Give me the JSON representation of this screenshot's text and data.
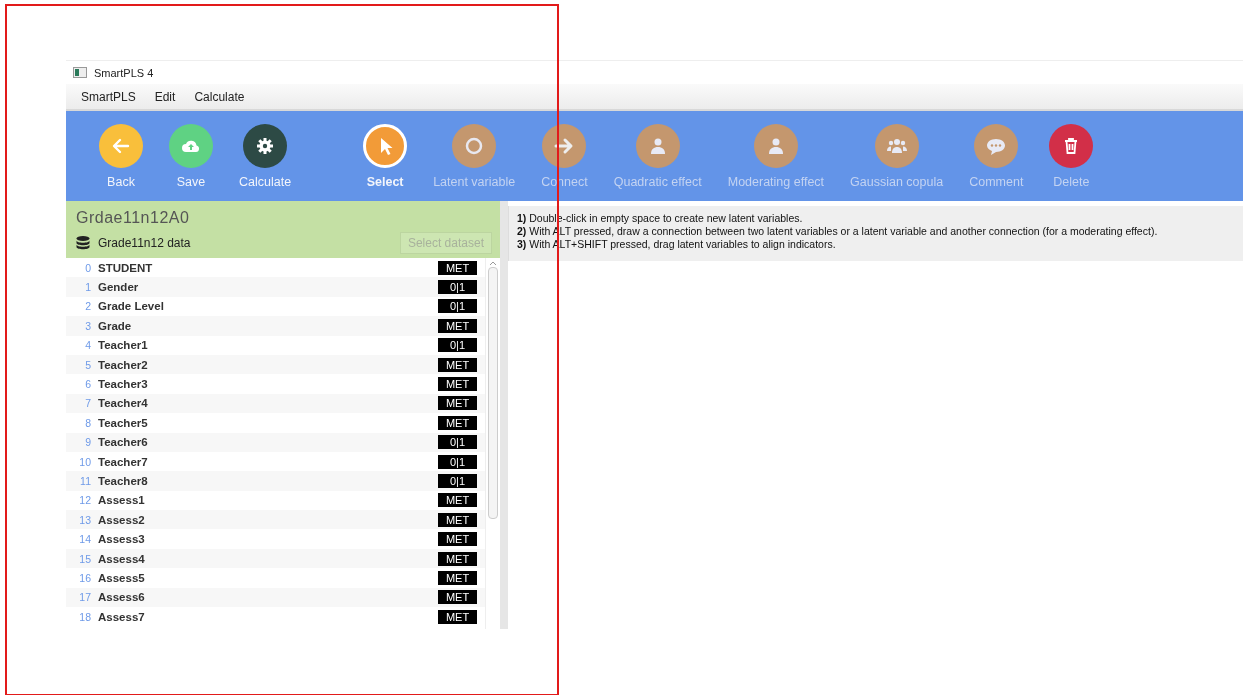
{
  "window": {
    "title": "SmartPLS 4"
  },
  "menu": [
    "SmartPLS",
    "Edit",
    "Calculate"
  ],
  "toolbar": [
    {
      "label": "Back",
      "kind": "back",
      "color": "#f9bf3b",
      "disabled": false,
      "selected": false
    },
    {
      "label": "Save",
      "kind": "save",
      "color": "#5fd283",
      "disabled": false,
      "selected": false
    },
    {
      "label": "Calculate",
      "kind": "gear",
      "color": "#2d4a45",
      "disabled": false,
      "selected": false
    },
    {
      "label": "Select",
      "kind": "pointer",
      "color": "#f29b38",
      "disabled": false,
      "selected": true
    },
    {
      "label": "Latent variable",
      "kind": "circle",
      "color": "#c4976e",
      "disabled": true,
      "selected": false
    },
    {
      "label": "Connect",
      "kind": "arrow",
      "color": "#c4976e",
      "disabled": true,
      "selected": false
    },
    {
      "label": "Quadratic effect",
      "kind": "person",
      "color": "#c4976e",
      "disabled": true,
      "selected": false
    },
    {
      "label": "Moderating effect",
      "kind": "person",
      "color": "#c4976e",
      "disabled": true,
      "selected": false
    },
    {
      "label": "Gaussian copula",
      "kind": "people",
      "color": "#c4976e",
      "disabled": true,
      "selected": false
    },
    {
      "label": "Comment",
      "kind": "comment",
      "color": "#c4976e",
      "disabled": true,
      "selected": false
    },
    {
      "label": "Delete",
      "kind": "trash",
      "color": "#d22f48",
      "disabled": true,
      "selected": false
    }
  ],
  "project": {
    "name": "Grdae11n12A0",
    "dataset": "Grade11n12 data",
    "select_button": "Select dataset"
  },
  "variables": [
    {
      "index": "0",
      "name": "STUDENT",
      "type": "MET"
    },
    {
      "index": "1",
      "name": "Gender",
      "type": "0|1"
    },
    {
      "index": "2",
      "name": "Grade Level",
      "type": "0|1"
    },
    {
      "index": "3",
      "name": "Grade",
      "type": "MET"
    },
    {
      "index": "4",
      "name": "Teacher1",
      "type": "0|1"
    },
    {
      "index": "5",
      "name": "Teacher2",
      "type": "MET"
    },
    {
      "index": "6",
      "name": "Teacher3",
      "type": "MET"
    },
    {
      "index": "7",
      "name": "Teacher4",
      "type": "MET"
    },
    {
      "index": "8",
      "name": "Teacher5",
      "type": "MET"
    },
    {
      "index": "9",
      "name": "Teacher6",
      "type": "0|1"
    },
    {
      "index": "10",
      "name": "Teacher7",
      "type": "0|1"
    },
    {
      "index": "11",
      "name": "Teacher8",
      "type": "0|1"
    },
    {
      "index": "12",
      "name": "Assess1",
      "type": "MET"
    },
    {
      "index": "13",
      "name": "Assess2",
      "type": "MET"
    },
    {
      "index": "14",
      "name": "Assess3",
      "type": "MET"
    },
    {
      "index": "15",
      "name": "Assess4",
      "type": "MET"
    },
    {
      "index": "16",
      "name": "Assess5",
      "type": "MET"
    },
    {
      "index": "17",
      "name": "Assess6",
      "type": "MET"
    },
    {
      "index": "18",
      "name": "Assess7",
      "type": "MET"
    }
  ],
  "hints": [
    "**1)** Double-click in empty space to create new latent variables.",
    "**2)** With ALT pressed, draw a connection between two latent variables or a latent variable and another connection (for a moderating effect).",
    "**3)** With ALT+SHIFT pressed, drag latent variables to align indicators."
  ],
  "highlight_frame": true
}
